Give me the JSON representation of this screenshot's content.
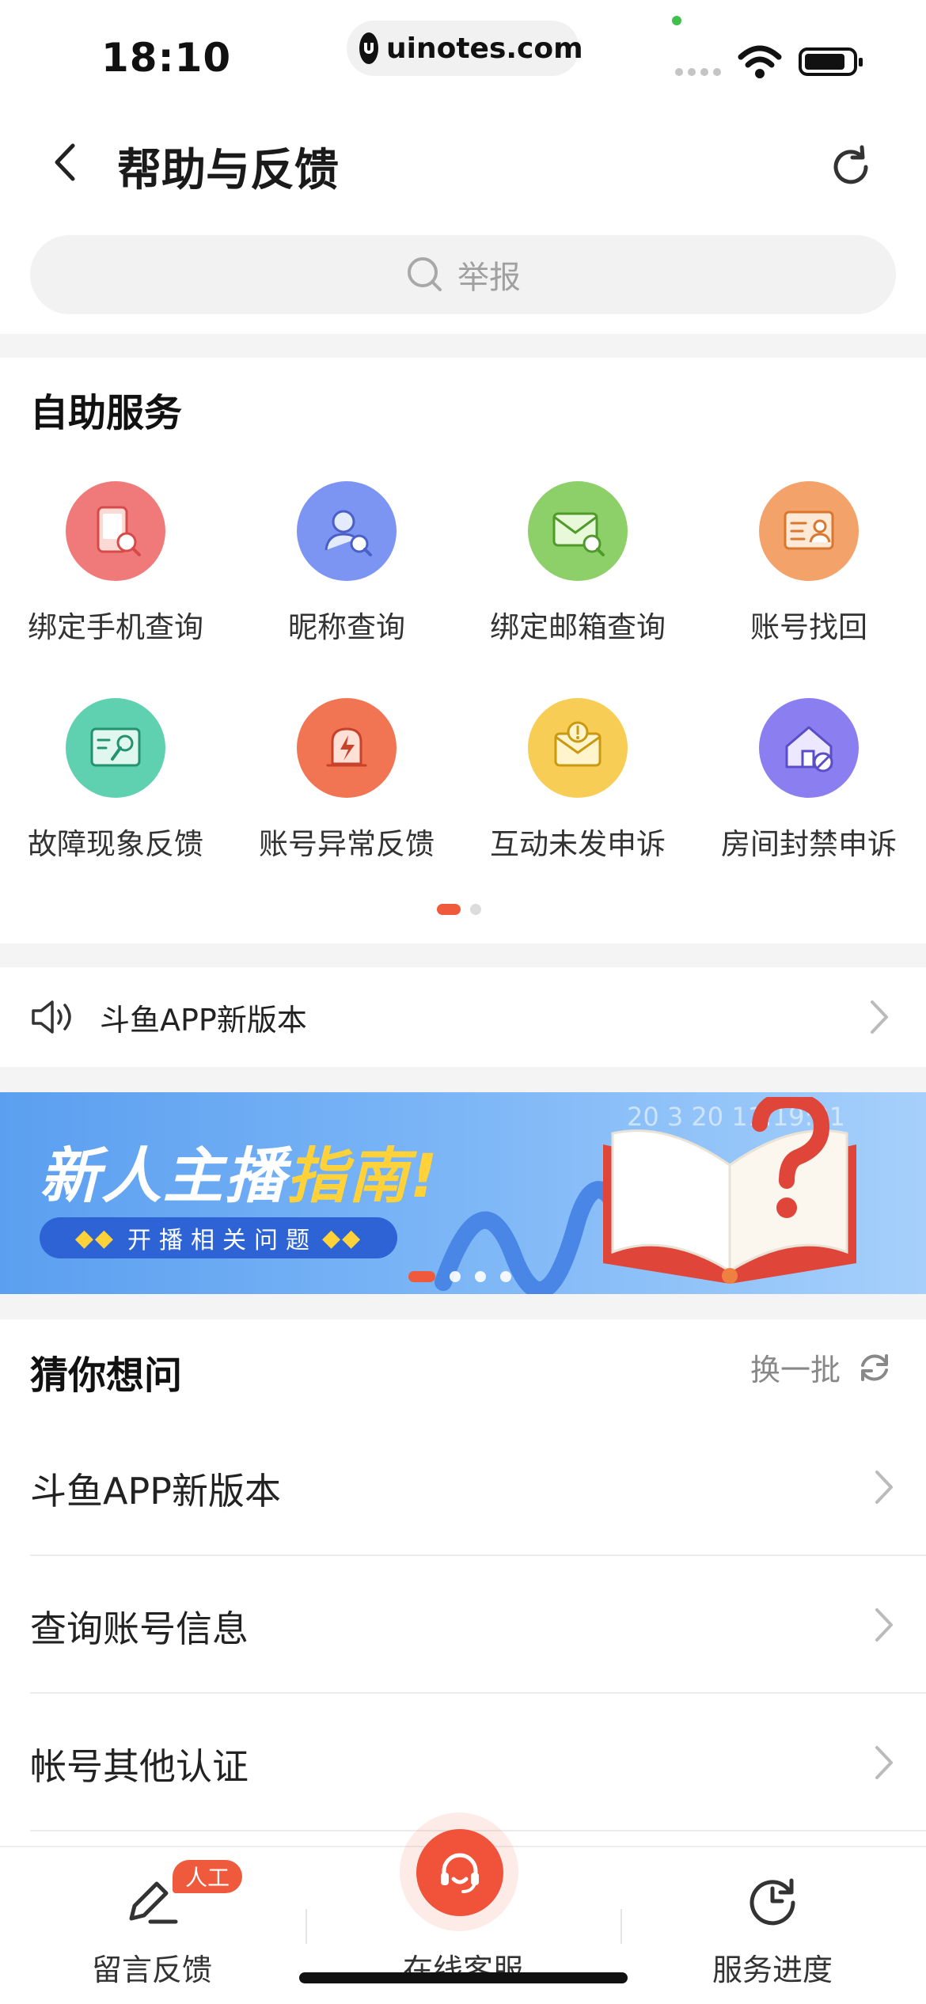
{
  "status_bar": {
    "time": "18:10",
    "url": "uinotes.com"
  },
  "header": {
    "title": "帮助与反馈"
  },
  "search": {
    "placeholder": "举报"
  },
  "self_service": {
    "title": "自助服务",
    "items": [
      {
        "label": "绑定手机查询",
        "icon": "phone-search-icon",
        "color": "#f07a7a"
      },
      {
        "label": "昵称查询",
        "icon": "user-search-icon",
        "color": "#7c95f2"
      },
      {
        "label": "绑定邮箱查询",
        "icon": "mail-search-icon",
        "color": "#8dd06a"
      },
      {
        "label": "账号找回",
        "icon": "id-card-icon",
        "color": "#f3a26a"
      },
      {
        "label": "故障现象反馈",
        "icon": "wrench-icon",
        "color": "#5fd0b0"
      },
      {
        "label": "账号异常反馈",
        "icon": "warning-icon",
        "color": "#f17553"
      },
      {
        "label": "互动未发申诉",
        "icon": "alert-mail-icon",
        "color": "#f7cd55"
      },
      {
        "label": "房间封禁申诉",
        "icon": "house-ban-icon",
        "color": "#8a7ef0"
      }
    ]
  },
  "notice": {
    "text": "斗鱼APP新版本"
  },
  "banner": {
    "title_main": "新人主播",
    "title_accent": "指南",
    "subtitle": "开播相关问题",
    "timestamp": "20 3 20 11:19:31"
  },
  "guess": {
    "title": "猜你想问",
    "refresh_label": "换一批",
    "items": [
      "斗鱼APP新版本",
      "查询账号信息",
      "帐号其他认证"
    ]
  },
  "tabbar": {
    "left_label": "留言反馈",
    "left_badge": "人工",
    "center_label": "在线客服",
    "right_label": "服务进度"
  },
  "colors": {
    "accent": "#f0523a",
    "banner_blue": "#5b9ff0"
  }
}
